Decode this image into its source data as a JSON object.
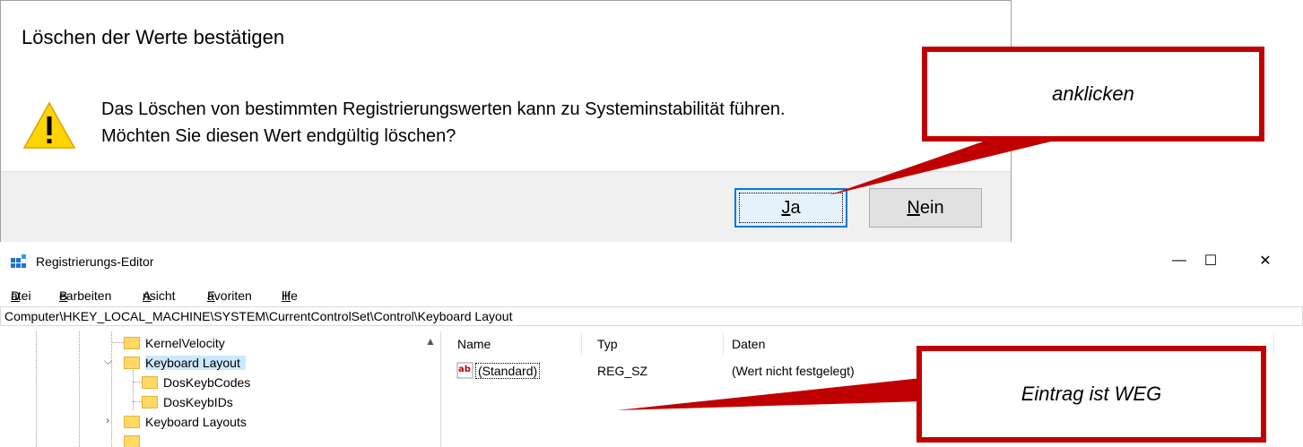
{
  "dialog": {
    "title": "Löschen der Werte bestätigen",
    "message_line1": "Das Löschen von bestimmten Registrierungswerten kann zu Systeminstabilität führen.",
    "message_line2": "Möchten Sie diesen Wert endgültig löschen?",
    "yes_mnemonic": "J",
    "yes_rest": "a",
    "no_mnemonic": "N",
    "no_rest": "ein"
  },
  "window": {
    "title": "Registrierungs-Editor",
    "minimize": "—",
    "maximize": "☐",
    "close": "✕"
  },
  "menu": [
    {
      "mnemonic": "D",
      "rest": "atei"
    },
    {
      "mnemonic": "B",
      "rest": "earbeiten"
    },
    {
      "mnemonic": "A",
      "rest": "nsicht"
    },
    {
      "mnemonic": "F",
      "rest": "avoriten"
    },
    {
      "mnemonic": "H",
      "rest": "ilfe"
    }
  ],
  "address": "Computer\\HKEY_LOCAL_MACHINE\\SYSTEM\\CurrentControlSet\\Control\\Keyboard Layout",
  "tree": [
    {
      "label": "KernelVelocity"
    },
    {
      "label": "Keyboard Layout"
    },
    {
      "label": "DosKeybCodes"
    },
    {
      "label": "DosKeybIDs"
    },
    {
      "label": "Keyboard Layouts"
    }
  ],
  "list": {
    "columns": [
      "Name",
      "Typ",
      "Daten"
    ],
    "rows": [
      {
        "name": "(Standard)",
        "type": "REG_SZ",
        "data": "(Wert nicht festgelegt)"
      }
    ]
  },
  "annotations": {
    "click_note": "anklicken",
    "gone_note": "Eintrag ist WEG"
  },
  "colors": {
    "annotation_red": "#c00000",
    "selection": "#cce8ff",
    "focus_blue": "#0078d7",
    "folder_yellow": "#ffd865"
  }
}
